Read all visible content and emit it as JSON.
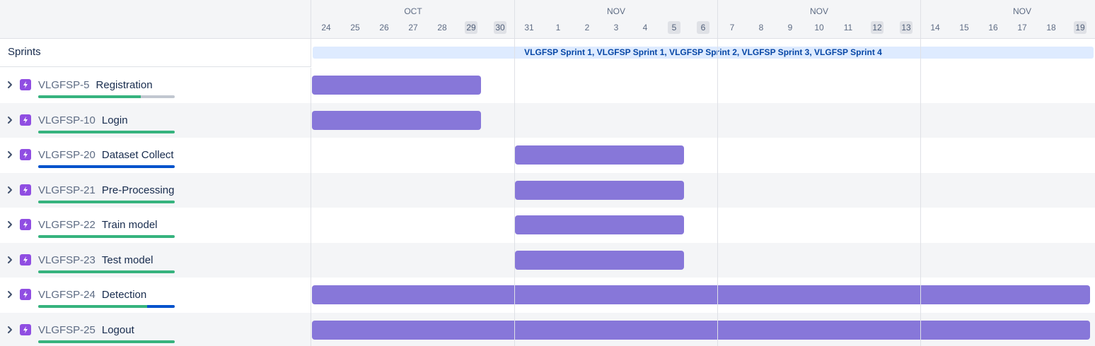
{
  "timeline": {
    "months": [
      "OCT",
      "NOV",
      "NOV",
      "NOV"
    ],
    "days": [
      "24",
      "25",
      "26",
      "27",
      "28",
      "29",
      "30",
      "31",
      "1",
      "2",
      "3",
      "4",
      "5",
      "6",
      "7",
      "8",
      "9",
      "10",
      "11",
      "12",
      "13",
      "14",
      "15",
      "16",
      "17",
      "18",
      "19"
    ],
    "weekend_days": [
      "29",
      "30",
      "5",
      "6",
      "12",
      "13",
      "19"
    ]
  },
  "sprints": {
    "label": "Sprints",
    "bar_text": "VLGFSP Sprint 1, VLGFSP Sprint 1, VLGFSP Sprint 2, VLGFSP Sprint 3, VLGFSP Sprint 4"
  },
  "colors": {
    "epic_icon": "#904ee2",
    "bar": "#8777d9",
    "done": "#36b37e",
    "in_progress": "#0052cc",
    "todo": "#c1c7d0"
  },
  "epics": [
    {
      "key": "VLGFSP-5",
      "summary": "Registration",
      "progress": {
        "done": 0.75,
        "in_progress": 0.0
      },
      "start": "Oct 24",
      "end": "Oct 29"
    },
    {
      "key": "VLGFSP-10",
      "summary": "Login",
      "progress": {
        "done": 1.0,
        "in_progress": 0.0
      },
      "start": "Oct 24",
      "end": "Oct 29"
    },
    {
      "key": "VLGFSP-20",
      "summary": "Dataset Collect",
      "progress": {
        "done": 0.0,
        "in_progress": 1.0
      },
      "start": "Oct 31",
      "end": "Nov 5"
    },
    {
      "key": "VLGFSP-21",
      "summary": "Pre-Processing",
      "progress": {
        "done": 1.0,
        "in_progress": 0.0
      },
      "start": "Oct 31",
      "end": "Nov 5"
    },
    {
      "key": "VLGFSP-22",
      "summary": "Train model",
      "progress": {
        "done": 1.0,
        "in_progress": 0.0
      },
      "start": "Oct 31",
      "end": "Nov 5"
    },
    {
      "key": "VLGFSP-23",
      "summary": "Test model",
      "progress": {
        "done": 1.0,
        "in_progress": 0.0
      },
      "start": "Oct 31",
      "end": "Nov 5"
    },
    {
      "key": "VLGFSP-24",
      "summary": "Detection",
      "progress": {
        "done": 0.8,
        "in_progress": 0.2
      },
      "start": "Oct 24",
      "end": "Nov 19"
    },
    {
      "key": "VLGFSP-25",
      "summary": "Logout",
      "progress": {
        "done": 1.0,
        "in_progress": 0.0
      },
      "start": "Oct 24",
      "end": "Nov 19"
    }
  ]
}
